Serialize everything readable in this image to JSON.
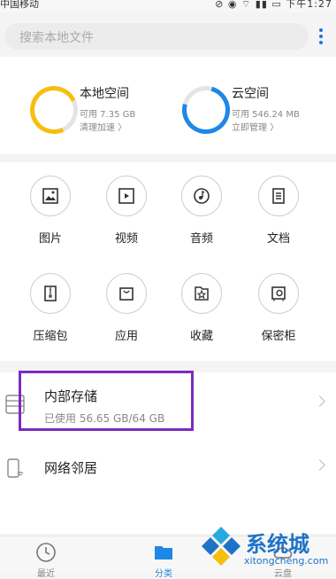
{
  "status": {
    "carrier": "中国移动",
    "time": "下午1:27"
  },
  "search": {
    "placeholder": "搜索本地文件"
  },
  "storage": {
    "local": {
      "title": "本地空间",
      "available": "可用 7.35 GB",
      "action": "清理加速 〉"
    },
    "cloud": {
      "title": "云空间",
      "available": "可用 546.24 MB",
      "action": "立即管理 〉"
    }
  },
  "categories": [
    {
      "label": "图片",
      "icon": "image-icon"
    },
    {
      "label": "视频",
      "icon": "video-icon"
    },
    {
      "label": "音频",
      "icon": "audio-icon"
    },
    {
      "label": "文档",
      "icon": "document-icon"
    },
    {
      "label": "压缩包",
      "icon": "archive-icon"
    },
    {
      "label": "应用",
      "icon": "app-bag-icon"
    },
    {
      "label": "收藏",
      "icon": "favorite-star-icon"
    },
    {
      "label": "保密柜",
      "icon": "safe-icon"
    }
  ],
  "list": {
    "internal": {
      "title": "内部存储",
      "subtitle": "已使用 56.65 GB/64 GB"
    },
    "network": {
      "title": "网络邻居"
    }
  },
  "tabs": [
    {
      "label": "最近",
      "icon": "clock-icon"
    },
    {
      "label": "分类",
      "icon": "folder-icon",
      "active": true
    },
    {
      "label": "云盘",
      "icon": "cloud-icon"
    }
  ],
  "watermark": {
    "brand": "系统城",
    "url": "xitongcheng.com"
  },
  "colors": {
    "accent": "#1e88e5",
    "local_ring": "#f6be0f",
    "highlight": "#7b2bbf"
  }
}
